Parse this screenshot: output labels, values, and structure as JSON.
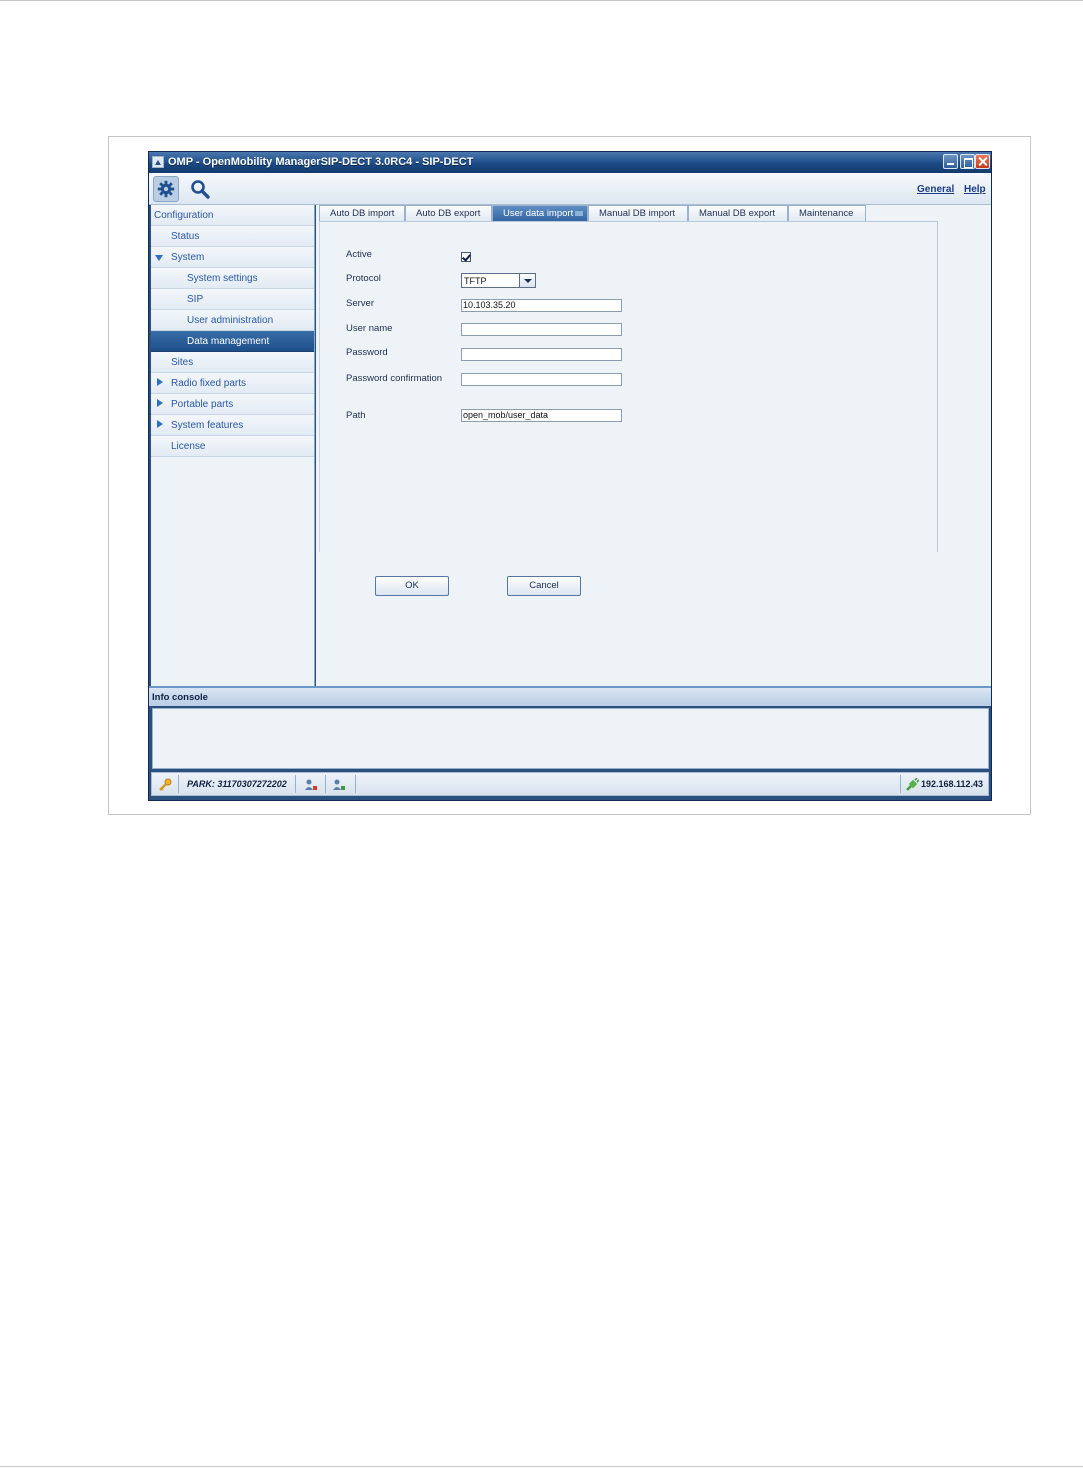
{
  "window": {
    "title": "OMP - OpenMobility ManagerSIP-DECT 3.0RC4 - SIP-DECT"
  },
  "toolbar": {
    "general_label": "General",
    "help_label": "Help"
  },
  "sidebar": {
    "items": [
      {
        "label": "Configuration"
      },
      {
        "label": "Status"
      },
      {
        "label": "System"
      },
      {
        "label": "System settings"
      },
      {
        "label": "SIP"
      },
      {
        "label": "User administration"
      },
      {
        "label": "Data management"
      },
      {
        "label": "Sites"
      },
      {
        "label": "Radio fixed parts"
      },
      {
        "label": "Portable parts"
      },
      {
        "label": "System features"
      },
      {
        "label": "License"
      }
    ]
  },
  "tabs": [
    {
      "label": "Auto DB import"
    },
    {
      "label": "Auto DB export"
    },
    {
      "label": "User data import"
    },
    {
      "label": "Manual DB import"
    },
    {
      "label": "Manual DB export"
    },
    {
      "label": "Maintenance"
    }
  ],
  "form": {
    "active_label": "Active",
    "active_checked": true,
    "protocol_label": "Protocol",
    "protocol_value": "TFTP",
    "server_label": "Server",
    "server_value": "10.103.35.20",
    "username_label": "User name",
    "username_value": "",
    "password_label": "Password",
    "password_value": "",
    "password_confirm_label": "Password confirmation",
    "password_confirm_value": "",
    "path_label": "Path",
    "path_value": "open_mob/user_data"
  },
  "buttons": {
    "ok": "OK",
    "cancel": "Cancel"
  },
  "console": {
    "title": "Info console"
  },
  "statusbar": {
    "park": "PARK: 31170307272202",
    "ip": "192.168.112.43"
  }
}
